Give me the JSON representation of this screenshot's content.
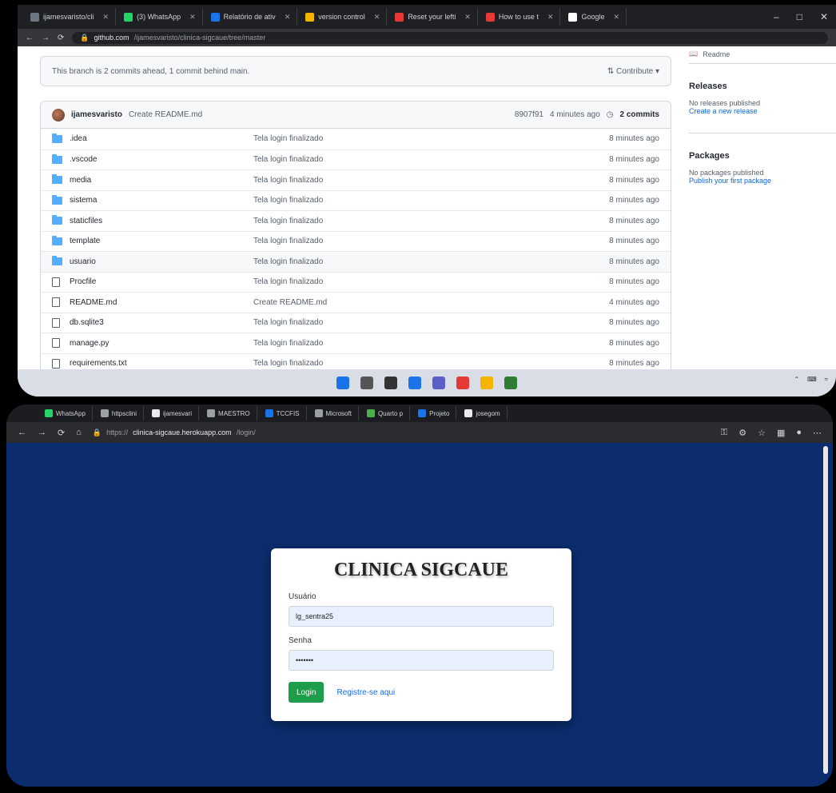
{
  "top": {
    "tabs": [
      {
        "label": "ijamesvaristo/cli",
        "color": "#6e7681"
      },
      {
        "label": "(3) WhatsApp",
        "color": "#25d366"
      },
      {
        "label": "Relatório de ativ",
        "color": "#1a73e8"
      },
      {
        "label": "version control",
        "color": "#f4b400"
      },
      {
        "label": "Reset your lefti",
        "color": "#e53935"
      },
      {
        "label": "How to use t",
        "color": "#e53935"
      },
      {
        "label": "Google",
        "color": "#ffffff"
      }
    ],
    "url_host": "github.com",
    "url_path": "/ijamesvaristo/clinica-sigcaue/tree/master",
    "ahead_text": "This branch is 2 commits ahead, 1 commit behind main.",
    "contribute_label": "Contribute",
    "commit": {
      "user": "ijamesvaristo",
      "message": "Create README.md",
      "hash": "8907f91",
      "time": "4 minutes ago",
      "commits": "2 commits"
    },
    "files": [
      {
        "name": ".idea",
        "message": "Tela login finalizado",
        "time": "8 minutes ago",
        "type": "folder"
      },
      {
        "name": ".vscode",
        "message": "Tela login finalizado",
        "time": "8 minutes ago",
        "type": "folder"
      },
      {
        "name": "media",
        "message": "Tela login finalizado",
        "time": "8 minutes ago",
        "type": "folder"
      },
      {
        "name": "sistema",
        "message": "Tela login finalizado",
        "time": "8 minutes ago",
        "type": "folder"
      },
      {
        "name": "staticfiles",
        "message": "Tela login finalizado",
        "time": "8 minutes ago",
        "type": "folder"
      },
      {
        "name": "template",
        "message": "Tela login finalizado",
        "time": "8 minutes ago",
        "type": "folder"
      },
      {
        "name": "usuario",
        "message": "Tela login finalizado",
        "time": "8 minutes ago",
        "type": "folder"
      },
      {
        "name": "Procfile",
        "message": "Tela login finalizado",
        "time": "8 minutes ago",
        "type": "file"
      },
      {
        "name": "README.md",
        "message": "Create README.md",
        "time": "4 minutes ago",
        "type": "file"
      },
      {
        "name": "db.sqlite3",
        "message": "Tela login finalizado",
        "time": "8 minutes ago",
        "type": "file"
      },
      {
        "name": "manage.py",
        "message": "Tela login finalizado",
        "time": "8 minutes ago",
        "type": "file"
      },
      {
        "name": "requirements.txt",
        "message": "Tela login finalizado",
        "time": "8 minutes ago",
        "type": "file"
      }
    ],
    "sidebar": {
      "readme": "Readme",
      "releases_title": "Releases",
      "releases_none": "No releases published",
      "releases_link": "Create a new release",
      "packages_title": "Packages",
      "packages_none": "No packages published",
      "packages_link": "Publish your first package"
    },
    "taskbar_colors": [
      "#1a73e8",
      "#555555",
      "#333333",
      "#1a73e8",
      "#5b5fc7",
      "#e53935",
      "#f4b400",
      "#2e7d32"
    ]
  },
  "bottom": {
    "tabs": [
      {
        "label": "WhatsApp",
        "color": "#25d366"
      },
      {
        "label": "httpsclini",
        "color": "#9aa0a6"
      },
      {
        "label": "ijamesvari",
        "color": "#e8eaed"
      },
      {
        "label": "MAESTRO",
        "color": "#9aa0a6"
      },
      {
        "label": "TCCFIS",
        "color": "#1a73e8"
      },
      {
        "label": "Microsoft",
        "color": "#9aa0a6"
      },
      {
        "label": "Quarto p",
        "color": "#4caf50"
      },
      {
        "label": "Projeto",
        "color": "#1a73e8"
      },
      {
        "label": "josegom",
        "color": "#e8eaed"
      }
    ],
    "url_prefix": "https://",
    "url_host": "clinica-sigcaue.herokuapp.com",
    "url_path": "/login/",
    "login": {
      "title": "CLINICA SIGCAUE",
      "user_label": "Usuário",
      "user_value": "lg_sentra25",
      "password_label": "Senha",
      "password_value": "•••••••",
      "button": "Login",
      "register": "Registre-se aqui"
    }
  }
}
